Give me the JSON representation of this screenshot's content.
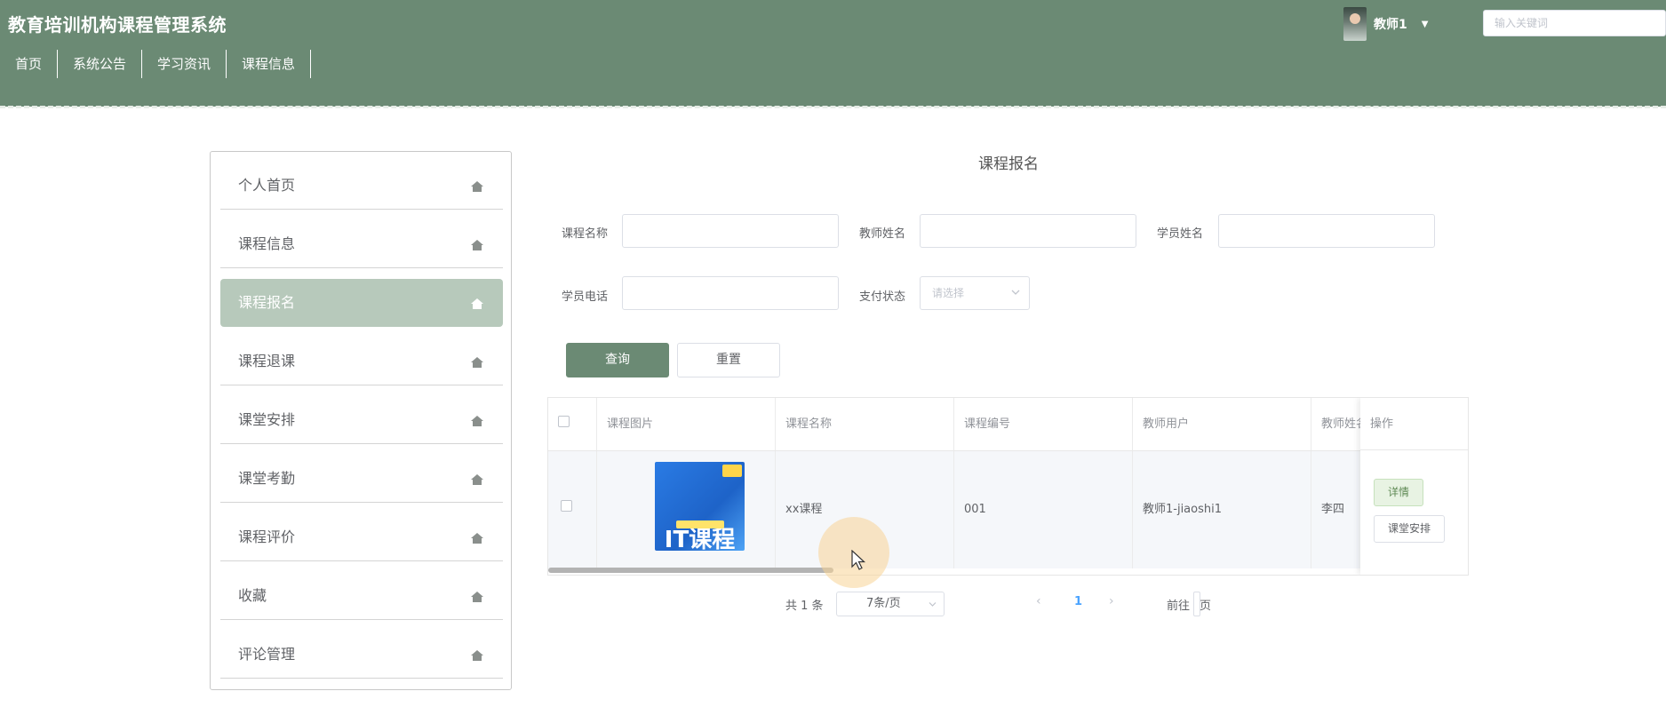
{
  "app": {
    "title": "教育培训机构课程管理系统"
  },
  "topnav": [
    "首页",
    "系统公告",
    "学习资讯",
    "课程信息"
  ],
  "user": {
    "name": "教师1"
  },
  "search": {
    "placeholder": "输入关键词"
  },
  "sidebar": {
    "items": [
      {
        "label": "个人首页",
        "active": false
      },
      {
        "label": "课程信息",
        "active": false
      },
      {
        "label": "课程报名",
        "active": true
      },
      {
        "label": "课程退课",
        "active": false
      },
      {
        "label": "课堂安排",
        "active": false
      },
      {
        "label": "课堂考勤",
        "active": false
      },
      {
        "label": "课程评价",
        "active": false
      },
      {
        "label": "收藏",
        "active": false
      },
      {
        "label": "评论管理",
        "active": false
      }
    ]
  },
  "page": {
    "title": "课程报名"
  },
  "filters": {
    "course_name": "课程名称",
    "teacher_name": "教师姓名",
    "student_name": "学员姓名",
    "student_phone": "学员电话",
    "pay_status": "支付状态",
    "pay_status_placeholder": "请选择"
  },
  "buttons": {
    "query": "查询",
    "reset": "重置"
  },
  "table": {
    "headers": [
      "课程图片",
      "课程名称",
      "课程编号",
      "教师用户",
      "教师姓名",
      "操作"
    ],
    "rows": [
      {
        "image_text": "IT课程",
        "course_name": "xx课程",
        "course_no": "001",
        "teacher_user": "教师1-jiaoshi1",
        "teacher_name": "李四"
      }
    ],
    "actions": {
      "detail": "详情",
      "schedule": "课堂安排"
    }
  },
  "pagination": {
    "total": "共 1 条",
    "page_size": "7条/页",
    "current_page": "1",
    "goto_label": "前往",
    "page_unit": "页"
  },
  "colors": {
    "header": "#6b8a74",
    "sidebar_active": "#b7c9bb",
    "link": "#4aa3ff"
  }
}
